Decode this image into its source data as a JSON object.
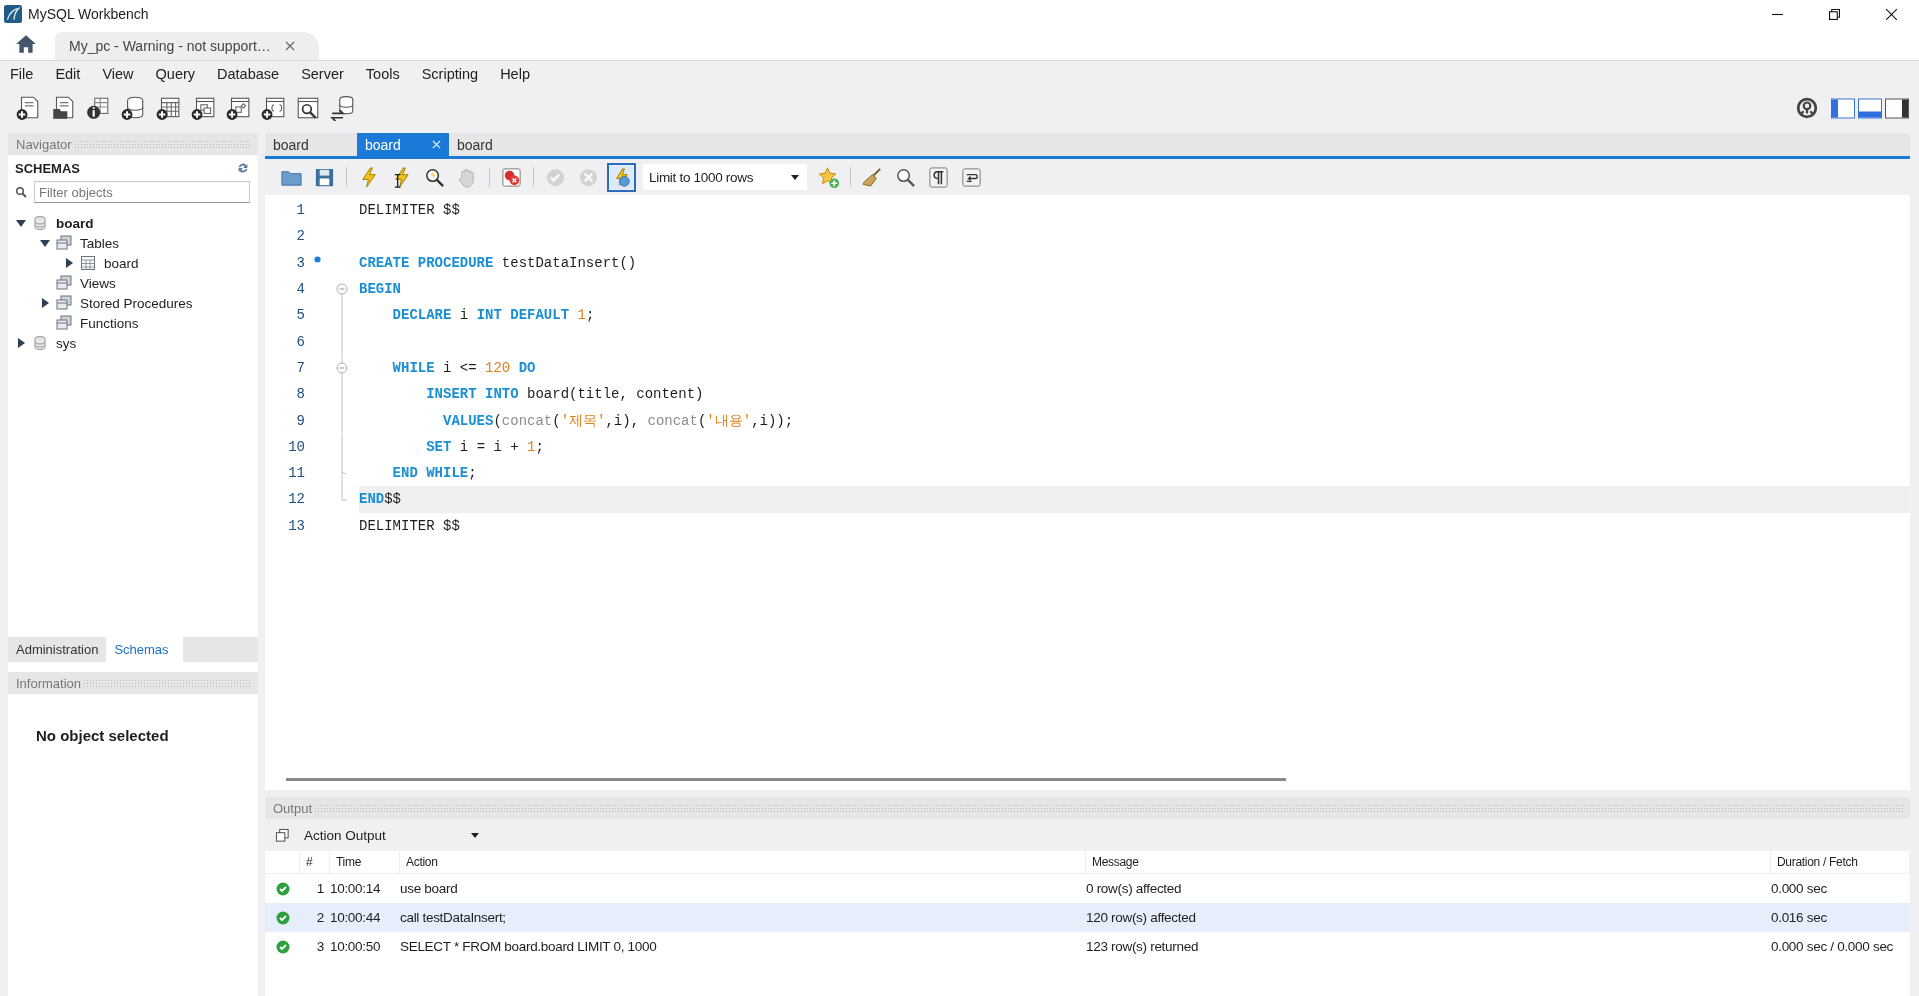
{
  "window": {
    "title": "MySQL Workbench"
  },
  "connection_tab": {
    "label": "My_pc - Warning - not support…"
  },
  "menu": [
    "File",
    "Edit",
    "View",
    "Query",
    "Database",
    "Server",
    "Tools",
    "Scripting",
    "Help"
  ],
  "panel_toggles": [
    {
      "on": true
    },
    {
      "on": true
    },
    {
      "on": false
    }
  ],
  "navigator": {
    "title": "Navigator",
    "schemas_label": "SCHEMAS",
    "filter": {
      "placeholder": "Filter objects"
    },
    "tree": [
      {
        "label": "board",
        "kind": "schema",
        "expandable": true,
        "expanded": true,
        "default": true,
        "children": [
          {
            "label": "Tables",
            "kind": "folder",
            "expandable": true,
            "expanded": true,
            "default": false,
            "children": [
              {
                "label": "board",
                "kind": "table",
                "expandable": true,
                "expanded": false,
                "default": false
              }
            ]
          },
          {
            "label": "Views",
            "kind": "folder",
            "expandable": false,
            "default": false
          },
          {
            "label": "Stored Procedures",
            "kind": "folder",
            "expandable": true,
            "expanded": false,
            "default": false
          },
          {
            "label": "Functions",
            "kind": "folder",
            "expandable": false,
            "default": false
          }
        ]
      },
      {
        "label": "sys",
        "kind": "schema",
        "expandable": true,
        "expanded": false,
        "default": false
      }
    ]
  },
  "sidebar_tabs": [
    {
      "label": "Administration",
      "selected": false
    },
    {
      "label": "Schemas",
      "selected": true
    }
  ],
  "information": {
    "title": "Information",
    "message": "No object selected"
  },
  "editor_tabs": [
    {
      "label": "board",
      "selected": false
    },
    {
      "label": "board",
      "selected": true
    },
    {
      "label": "board",
      "selected": false
    }
  ],
  "editor_toolbar": {
    "limit": "Limit to 1000 rows",
    "buttons": [
      {
        "disabled": false,
        "pressed": false
      },
      {
        "disabled": false,
        "pressed": false
      },
      {
        "disabled": false,
        "pressed": false
      },
      {
        "disabled": false,
        "pressed": false
      },
      {
        "disabled": false,
        "pressed": false
      },
      {
        "disabled": true,
        "pressed": false
      },
      {
        "disabled": false,
        "pressed": false
      },
      {
        "disabled": true,
        "pressed": false
      },
      {
        "disabled": true,
        "pressed": false
      },
      {
        "disabled": false,
        "pressed": true
      },
      {
        "disabled": false,
        "pressed": false
      },
      {
        "disabled": false,
        "pressed": false
      },
      {
        "disabled": false,
        "pressed": false
      },
      {
        "disabled": false,
        "pressed": false
      },
      {
        "disabled": false,
        "pressed": false
      }
    ]
  },
  "code_lines": [
    {
      "number": "1",
      "marked": false,
      "current": false,
      "foldable": false,
      "tokens": [
        {
          "kind": "plain",
          "text": "DELIMITER $$"
        }
      ]
    },
    {
      "number": "2",
      "marked": false,
      "foldable": false
    },
    {
      "number": "3",
      "marked": true,
      "current": false,
      "foldable": false,
      "tokens": [
        {
          "kind": "keyword",
          "text": "CREATE PROCEDURE"
        },
        {
          "kind": "plain",
          "text": " testDataInsert()"
        }
      ]
    },
    {
      "number": "4",
      "marked": false,
      "current": false,
      "foldable": true,
      "tokens": [
        {
          "kind": "keyword",
          "text": "BEGIN"
        }
      ]
    },
    {
      "number": "5",
      "marked": false,
      "current": false,
      "foldable": false,
      "tokens": [
        {
          "kind": "keyword",
          "text": "    DECLARE"
        },
        {
          "kind": "plain",
          "text": " i "
        },
        {
          "kind": "keyword",
          "text": "INT DEFAULT "
        },
        {
          "kind": "number",
          "text": "1"
        },
        {
          "kind": "plain",
          "text": ";"
        }
      ]
    },
    {
      "number": "6",
      "marked": false,
      "foldable": false
    },
    {
      "number": "7",
      "marked": false,
      "current": false,
      "foldable": true,
      "tokens": [
        {
          "kind": "keyword",
          "text": "    WHILE"
        },
        {
          "kind": "plain",
          "text": " i <= "
        },
        {
          "kind": "number",
          "text": "120"
        },
        {
          "kind": "keyword",
          "text": " DO"
        }
      ]
    },
    {
      "number": "8",
      "marked": false,
      "current": false,
      "foldable": false,
      "tokens": [
        {
          "kind": "keyword",
          "text": "        INSERT INTO"
        },
        {
          "kind": "plain",
          "text": " board(title, content)"
        }
      ]
    },
    {
      "number": "9",
      "marked": false,
      "current": false,
      "foldable": false,
      "tokens": [
        {
          "kind": "keyword",
          "text": "          VALUES"
        },
        {
          "kind": "plain",
          "text": "("
        },
        {
          "kind": "function",
          "text": "concat"
        },
        {
          "kind": "plain",
          "text": "("
        },
        {
          "kind": "string",
          "text": "'제목'"
        },
        {
          "kind": "plain",
          "text": ",i), "
        },
        {
          "kind": "function",
          "text": "concat"
        },
        {
          "kind": "plain",
          "text": "("
        },
        {
          "kind": "string",
          "text": "'내용'"
        },
        {
          "kind": "plain",
          "text": ",i));"
        }
      ]
    },
    {
      "number": "10",
      "marked": false,
      "current": false,
      "foldable": false,
      "tokens": [
        {
          "kind": "keyword",
          "text": "        SET"
        },
        {
          "kind": "plain",
          "text": " i = i + "
        },
        {
          "kind": "number",
          "text": "1"
        },
        {
          "kind": "plain",
          "text": ";"
        }
      ]
    },
    {
      "number": "11",
      "marked": false,
      "current": false,
      "foldable": false,
      "tokens": [
        {
          "kind": "keyword",
          "text": "    END WHILE"
        },
        {
          "kind": "plain",
          "text": ";"
        }
      ]
    },
    {
      "number": "12",
      "marked": false,
      "current": true,
      "foldable": false,
      "tokens": [
        {
          "kind": "keyword",
          "text": "END"
        },
        {
          "kind": "plain",
          "text": "$$"
        }
      ]
    },
    {
      "number": "13",
      "marked": false,
      "current": false,
      "foldable": false,
      "tokens": [
        {
          "kind": "plain",
          "text": "DELIMITER $$"
        }
      ]
    }
  ],
  "output": {
    "title": "Output",
    "mode": "Action Output",
    "columns": [
      "#",
      "Time",
      "Action",
      "Message",
      "Duration / Fetch"
    ],
    "rows": [
      {
        "success": true,
        "number": "1",
        "time": "10:00:14",
        "action": "use board",
        "message": "0 row(s) affected",
        "duration": "0.000 sec",
        "selected": false
      },
      {
        "success": true,
        "number": "2",
        "time": "10:00:44",
        "action": "call testDataInsert;",
        "message": "120 row(s) affected",
        "duration": "0.016 sec",
        "selected": true
      },
      {
        "success": true,
        "number": "3",
        "time": "10:00:50",
        "action": "SELECT * FROM board.board LIMIT 0, 1000",
        "message": "123 row(s) returned",
        "duration": "0.000 sec / 0.000 sec",
        "selected": false
      }
    ]
  }
}
